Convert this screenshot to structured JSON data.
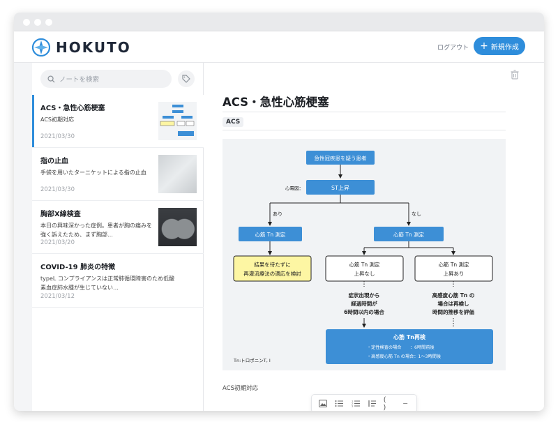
{
  "header": {
    "brand": "HOKUTO",
    "logout_label": "ログアウト",
    "new_button_label": "新規作成"
  },
  "sidebar": {
    "search_placeholder": "ノートを検索",
    "notes": [
      {
        "title": "ACS・急性心筋梗塞",
        "body": "ACS初期対応",
        "date": "2021/03/30",
        "active": true
      },
      {
        "title": "指の止血",
        "body": "手袋を用いたターニケットによる指の止血",
        "date": "2021/03/30"
      },
      {
        "title": "胸部X線検査",
        "body": "本日の興味深かった症例。患者が胸の痛みを強く訴えたため、まず胸部…",
        "date": "2021/03/20"
      },
      {
        "title": "COVID-19 肺炎の特徴",
        "body": "typeL コンプライアンスは正常肺循環障害のため低酸素血症肺水腫が生じていない…",
        "date": "2021/03/12"
      }
    ]
  },
  "note": {
    "title": "ACS・急性心筋梗塞",
    "tag": "ACS",
    "caption": "ACS初期対応"
  },
  "flowchart": {
    "start": "急性冠疾患を疑う患者",
    "ecg_label": "心電図：",
    "st": "ST上昇",
    "yes": "あり",
    "no": "なし",
    "tn_left": "心筋 Tn 測定",
    "tn_right": "心筋 Tn 測定",
    "wait_line1": "結果を待たずに",
    "wait_line2": "再灌流療法の適応を検討",
    "noraise_line1": "心筋 Tn 測定",
    "noraise_line2": "上昇なし",
    "raise_line1": "心筋 Tn 測定",
    "raise_line2": "上昇あり",
    "onset_line1": "症状出現から",
    "onset_line2": "経過時間が",
    "onset_line3": "6時間以内の場合",
    "hs_line1": "高感度心筋 Tn の",
    "hs_line2": "場合は再検し",
    "hs_line3": "時間的推移を評価",
    "recheck_title": "心筋 Tn再検",
    "recheck_line1": "・定性検査の場合　　：6時間前後",
    "recheck_line2": "・高感度心筋 Tn の場合：1〜3時間後",
    "footnote": "Tn:トロポニンT, I"
  },
  "colors": {
    "accent": "#2e8ddb",
    "flow_blue": "#3d8fd6",
    "flow_yellow": "#fdf6a3"
  }
}
